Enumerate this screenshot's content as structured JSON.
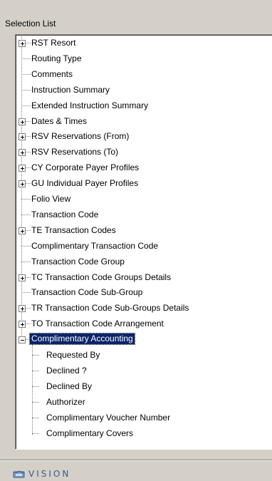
{
  "panel": {
    "title": "Selection List"
  },
  "tree": {
    "items": [
      {
        "label": "RST  Resort",
        "expandable": true,
        "expanded": false,
        "level": 0
      },
      {
        "label": "Routing Type",
        "expandable": false,
        "level": 0
      },
      {
        "label": "Comments",
        "expandable": false,
        "level": 0
      },
      {
        "label": "Instruction Summary",
        "expandable": false,
        "level": 0
      },
      {
        "label": "Extended Instruction Summary",
        "expandable": false,
        "level": 0
      },
      {
        "label": "Dates & Times",
        "expandable": true,
        "expanded": false,
        "level": 0
      },
      {
        "label": "RSV  Reservations (From)",
        "expandable": true,
        "expanded": false,
        "level": 0
      },
      {
        "label": "RSV  Reservations (To)",
        "expandable": true,
        "expanded": false,
        "level": 0
      },
      {
        "label": "CY  Corporate Payer Profiles",
        "expandable": true,
        "expanded": false,
        "level": 0
      },
      {
        "label": "GU  Individual Payer Profiles",
        "expandable": true,
        "expanded": false,
        "level": 0
      },
      {
        "label": "Folio View",
        "expandable": false,
        "level": 0
      },
      {
        "label": "Transaction Code",
        "expandable": false,
        "level": 0
      },
      {
        "label": "TE  Transaction Codes",
        "expandable": true,
        "expanded": false,
        "level": 0
      },
      {
        "label": "Complimentary Transaction Code",
        "expandable": false,
        "level": 0
      },
      {
        "label": "Transaction Code Group",
        "expandable": false,
        "level": 0
      },
      {
        "label": "TC  Transaction Code Groups Details",
        "expandable": true,
        "expanded": false,
        "level": 0
      },
      {
        "label": "Transaction Code Sub-Group",
        "expandable": false,
        "level": 0
      },
      {
        "label": "TR  Transaction Code Sub-Groups Details",
        "expandable": true,
        "expanded": false,
        "level": 0
      },
      {
        "label": "TO  Transaction Code Arrangement",
        "expandable": true,
        "expanded": false,
        "level": 0
      },
      {
        "label": "Complimentary Accounting",
        "expandable": true,
        "expanded": true,
        "level": 0,
        "selected": true
      },
      {
        "label": "Requested By",
        "expandable": false,
        "level": 1
      },
      {
        "label": "Declined ?",
        "expandable": false,
        "level": 1
      },
      {
        "label": "Declined By",
        "expandable": false,
        "level": 1
      },
      {
        "label": "Authorizer",
        "expandable": false,
        "level": 1
      },
      {
        "label": "Complimentary Voucher Number",
        "expandable": false,
        "level": 1
      },
      {
        "label": "Complimentary Covers",
        "expandable": false,
        "level": 1
      }
    ]
  },
  "footer": {
    "logo_text": "VISION",
    "logo_icon": "vision-logo-icon"
  },
  "colors": {
    "window_bg": "#d4d0c8",
    "selection_bg": "#0a246a",
    "selection_fg": "#ffffff"
  }
}
